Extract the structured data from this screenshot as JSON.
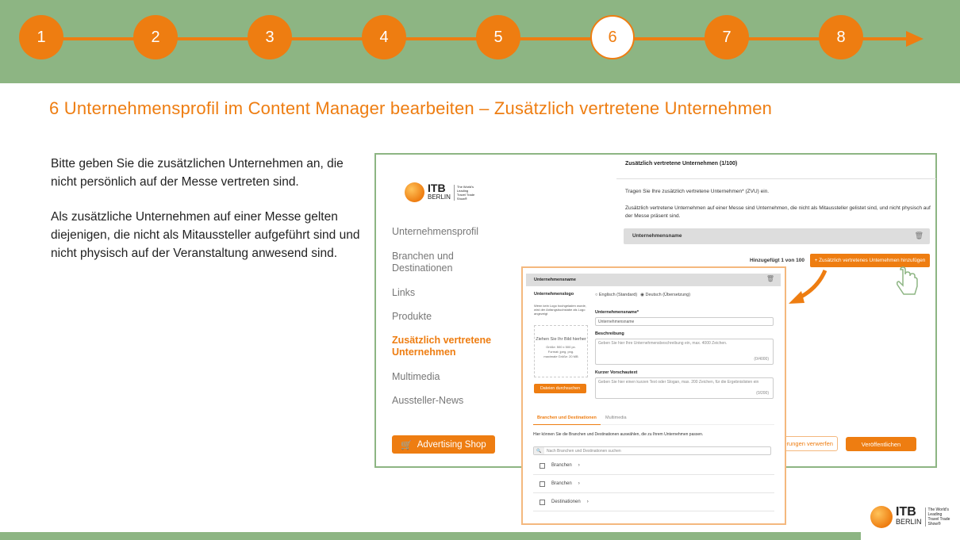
{
  "steps": [
    "1",
    "2",
    "3",
    "4",
    "5",
    "6",
    "7",
    "8"
  ],
  "active_step": "6",
  "title": "6 Unternehmensprofil im Content Manager bearbeiten – Zusätzlich vertretene Unternehmen",
  "intro": [
    "Bitte geben Sie die zusätzlichen Unternehmen an, die nicht persönlich auf der Messe vertreten sind.",
    "Als zusätzliche Unternehmen auf einer Messe gelten diejenigen, die nicht als Mitaussteller aufgeführt sind und nicht physisch auf der Veranstaltung anwesend sind."
  ],
  "logo": {
    "name": "ITB",
    "city": "BERLIN",
    "tagline": "The World's Leading Travel Trade Show®"
  },
  "sidebar": [
    {
      "label": "Unternehmensprofil"
    },
    {
      "label": "Branchen und Destinationen"
    },
    {
      "label": "Links"
    },
    {
      "label": "Produkte"
    },
    {
      "label": "Zusätzlich vertretene Unternehmen",
      "active": true
    },
    {
      "label": "Multimedia"
    },
    {
      "label": "Aussteller-News"
    }
  ],
  "shop_button": "Advertising Shop",
  "main": {
    "header": "Zusätzlich vertretene Unternehmen (1/100)",
    "text1": "Tragen Sie Ihre zusätzlich vertretene Unternehmen* (ZVU) ein.",
    "text2": "Zusätzlich vertretene Unternehmen auf einer Messe sind Unternehmen, die nicht als Mitaussteller gelistet sind, und nicht physisch auf der Messe präsent sind.",
    "entry_name": "Unternehmensname",
    "added": "Hinzugefügt 1 von 100",
    "add_button": "+ Zusätzlich vertretenes Unternehmen hinzufügen",
    "discard_button": "Änderungen verwerfen",
    "publish_button": "Veröffentlichen"
  },
  "popup": {
    "header": "Unternehmensname",
    "logo_label": "Unternehmenslogo",
    "logo_hint": "Wenn kein Logo hochgeladen wurde, wird der Anfangsbuchstabe als Logo angezeigt",
    "drop_title": "Ziehen Sie Ihr Bild hierher",
    "drop_info": "Größe: 500 x 500 px. Format: jpeg, png. maximale Größe: 20 MB",
    "browse_button": "Dateien durchsuchen",
    "lang_en": "Englisch (Standard)",
    "lang_de": "Deutsch (Übersetzung)",
    "name_label": "Unternehmensname*",
    "name_value": "Unternehmensname",
    "desc_label": "Beschreibung",
    "desc_placeholder": "Geben Sie hier Ihre Unternehmensbeschreibung ein, max. 4000 Zeichen.",
    "desc_count": "(0/4000)",
    "short_label": "Kurzer Vorschautext",
    "short_placeholder": "Geben Sie hier einen kurzen Text oder Slogan, max. 200 Zeichen, für die Ergebnislisten ein",
    "short_count": "(0/200)",
    "tabs": [
      "Branchen und Destinationen",
      "Multimedia"
    ],
    "tab_text": "Hier können Sie die Branchen und Destinationen auswählen, die zu Ihrem Unternehmen passen.",
    "search_placeholder": "Nach Branchen und Destinationen suchen",
    "rows": [
      "Branchen",
      "Branchen",
      "Destinationen"
    ]
  },
  "colors": {
    "accent": "#ee7d11",
    "green": "#8db583"
  }
}
